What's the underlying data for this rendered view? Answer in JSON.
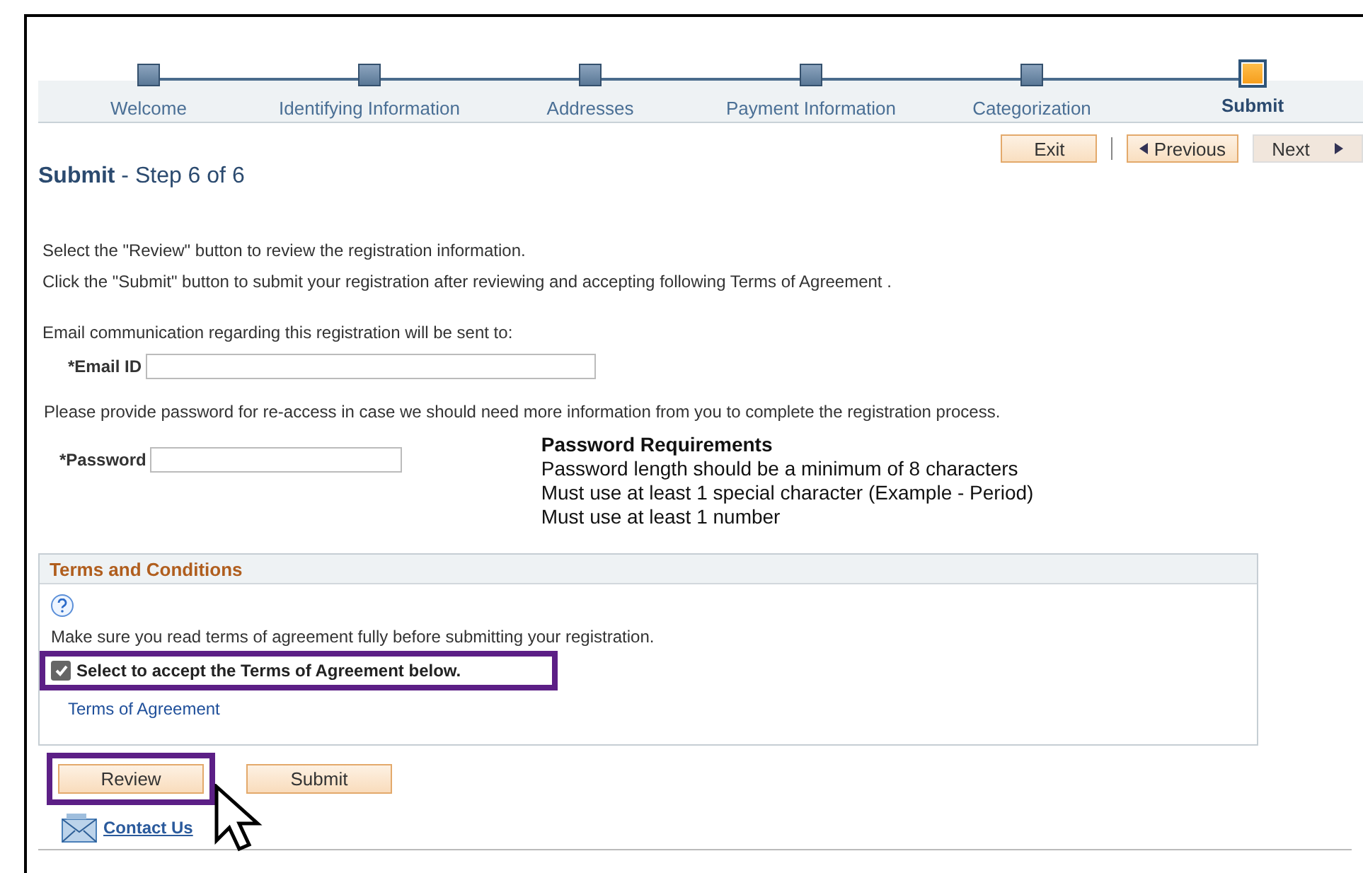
{
  "steps": [
    {
      "label": "Welcome",
      "selected": false
    },
    {
      "label": "Identifying Information",
      "selected": false
    },
    {
      "label": "Addresses",
      "selected": false
    },
    {
      "label": "Payment Information",
      "selected": false
    },
    {
      "label": "Categorization",
      "selected": false
    },
    {
      "label": "Submit",
      "selected": true
    }
  ],
  "nav_buttons": [
    {
      "kind": "exit",
      "label": "Exit",
      "disabled": false
    },
    {
      "kind": "previous",
      "label": "Previous",
      "disabled": false
    },
    {
      "kind": "next",
      "label": "Next",
      "disabled": true
    }
  ],
  "page_title": {
    "title": "Submit",
    "subtitle": "- Step 6 of 6"
  },
  "instructions": [
    "Select the \"Review\" button to review the registration information.",
    "Click the \"Submit\" button to submit your registration after reviewing and accepting following Terms of Agreement ."
  ],
  "email": {
    "intro": "Email communication regarding this registration will be sent to:",
    "label": "*Email ID"
  },
  "password": {
    "intro": "Please provide password for re-access in case we should need more information from you to complete the registration process.",
    "label": "*Password"
  },
  "password_requirements": {
    "title": "Password Requirements",
    "lines": [
      "Password length should be a minimum of 8 characters",
      "Must use at least 1 special character (Example - Period)",
      "Must use at least 1 number"
    ]
  },
  "terms": {
    "title": "Terms and Conditions",
    "notice": "Make sure you read terms of agreement fully before submitting your registration.",
    "accept": {
      "label": "Select to accept the Terms of Agreement below.",
      "checked": true,
      "highlighted": true
    },
    "link": "Terms of Agreement"
  },
  "actions": [
    {
      "label": "Review",
      "highlighted": true
    },
    {
      "label": "Submit",
      "highlighted": false
    }
  ],
  "contact": "Contact Us"
}
